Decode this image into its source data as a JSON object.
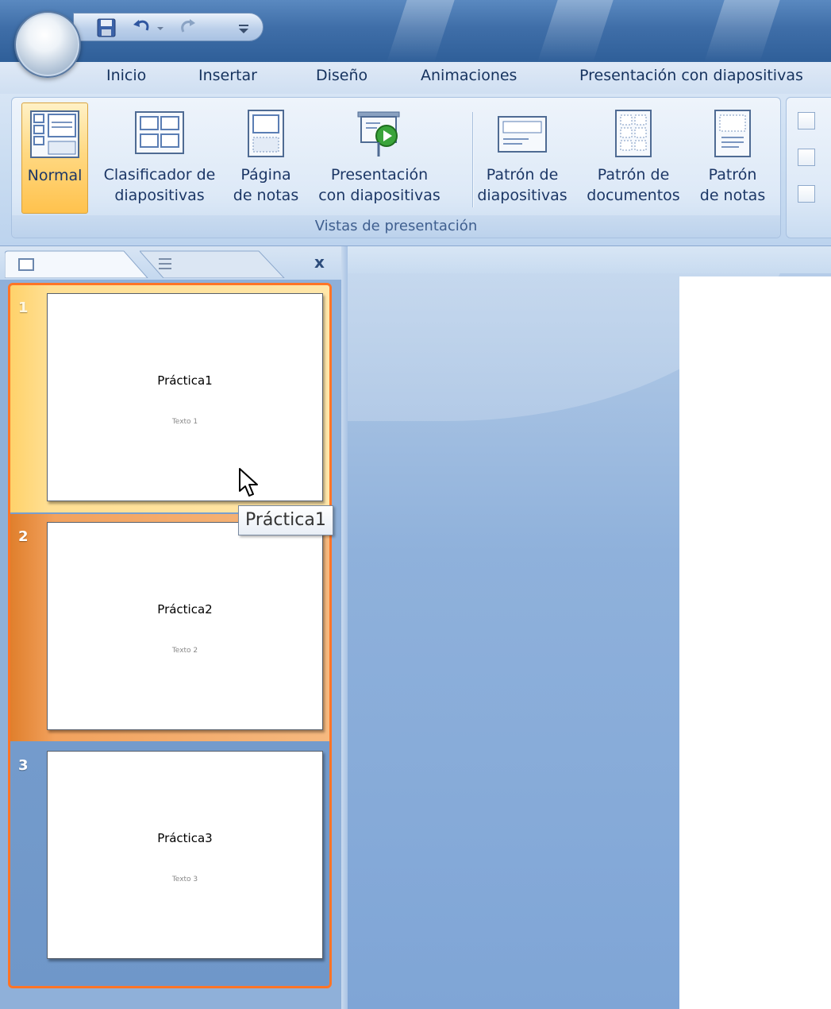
{
  "quick_access": {
    "save_icon": "save-icon",
    "undo_icon": "undo-icon",
    "redo_icon": "redo-icon",
    "customize_icon": "customize-qat-icon"
  },
  "tabs": [
    "Inicio",
    "Insertar",
    "Diseño",
    "Animaciones",
    "Presentación con diapositivas"
  ],
  "ribbon": {
    "group_label": "Vistas de presentación",
    "buttons": [
      {
        "line1": "Normal",
        "line2": "",
        "icon": "normal-view-icon",
        "active": true
      },
      {
        "line1": "Clasificador de",
        "line2": "diapositivas",
        "icon": "slide-sorter-icon",
        "active": false
      },
      {
        "line1": "Página",
        "line2": "de notas",
        "icon": "notes-page-icon",
        "active": false
      },
      {
        "line1": "Presentación",
        "line2": "con diapositivas",
        "icon": "slideshow-icon",
        "active": false
      },
      {
        "line1": "Patrón de",
        "line2": "diapositivas",
        "icon": "slide-master-icon",
        "active": false
      },
      {
        "line1": "Patrón de",
        "line2": "documentos",
        "icon": "handout-master-icon",
        "active": false
      },
      {
        "line1": "Patrón",
        "line2": "de notas",
        "icon": "notes-master-icon",
        "active": false
      }
    ]
  },
  "pane": {
    "close_label": "x",
    "slides": [
      {
        "number": "1",
        "title": "Práctica1",
        "subtitle": "Texto 1"
      },
      {
        "number": "2",
        "title": "Práctica2",
        "subtitle": "Texto 2"
      },
      {
        "number": "3",
        "title": "Práctica3",
        "subtitle": "Texto 3"
      }
    ]
  },
  "tooltip": "Práctica1",
  "colors": {
    "selection_border": "#ff7426",
    "active_button": "#ffd983",
    "title_bar": "#3f6ea8"
  }
}
